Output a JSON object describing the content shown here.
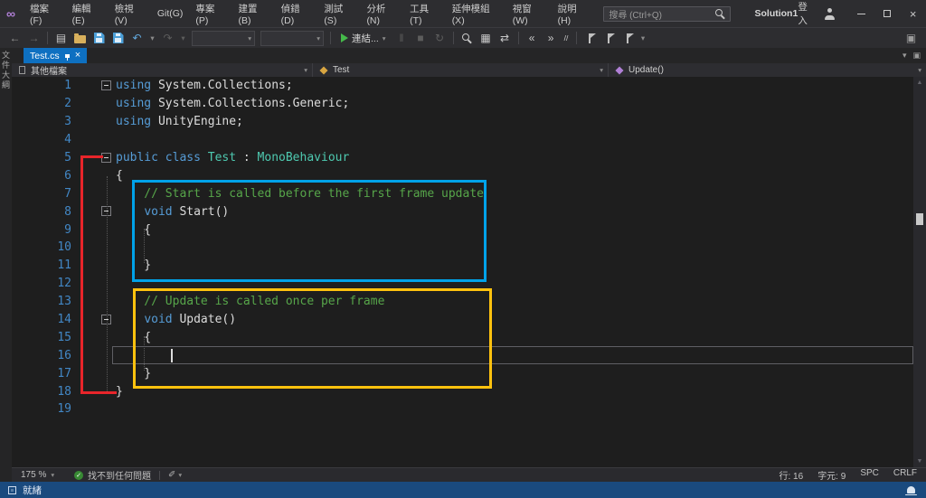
{
  "colors": {
    "keyword": "#569cd6",
    "type": "#4ec9b0",
    "comment": "#57a64a",
    "plain": "#dcdcdc",
    "line_number": "#4287c5",
    "editor_bg": "#1e1e1e",
    "active_tab": "#0e70c1",
    "statusbar_bg": "#1a4a7e",
    "annotation_red": "#e8252a",
    "annotation_blue": "#00a2e9",
    "annotation_yellow": "#ffc20e"
  },
  "titlebar": {
    "menus": [
      "檔案(F)",
      "編輯(E)",
      "檢視(V)",
      "Git(G)",
      "專案(P)",
      "建置(B)",
      "偵錯(D)",
      "測試(S)",
      "分析(N)",
      "工具(T)",
      "延伸模組(X)",
      "視窗(W)",
      "說明(H)"
    ],
    "search_placeholder": "搜尋 (Ctrl+Q)",
    "solution_name": "Solution1",
    "sign_in": "登入"
  },
  "toolbar": {
    "items": [
      {
        "type": "icon",
        "name": "nav-back-icon",
        "glyph": "←",
        "color": "#9b9b9b"
      },
      {
        "type": "icon",
        "name": "nav-forward-icon",
        "glyph": "→",
        "color": "#6d6d6d"
      },
      {
        "type": "sep"
      },
      {
        "type": "icon",
        "name": "new-file-icon",
        "glyph": "▤",
        "color": "#c8c8c8"
      },
      {
        "type": "shape",
        "name": "open-file-icon",
        "cls": "shape-folder"
      },
      {
        "type": "shape",
        "name": "save-icon",
        "cls": "shape-floppy"
      },
      {
        "type": "shape",
        "name": "save-all-icon",
        "cls": "shape-floppy-all"
      },
      {
        "type": "icon",
        "name": "undo-icon",
        "glyph": "↶",
        "color": "#62a8dc"
      },
      {
        "type": "icon",
        "name": "undo-dropdown-icon",
        "glyph": "▾",
        "color": "#8a8a8a",
        "small": true
      },
      {
        "type": "icon",
        "name": "redo-icon",
        "glyph": "↷",
        "color": "#5d5d5d"
      },
      {
        "type": "icon",
        "name": "redo-dropdown-icon",
        "glyph": "▾",
        "color": "#5d5d5d",
        "small": true
      },
      {
        "type": "combo",
        "name": "configuration-combo"
      },
      {
        "type": "combo",
        "name": "platform-combo"
      },
      {
        "type": "sep"
      },
      {
        "type": "start",
        "name": "attach-button",
        "label": "連結..."
      },
      {
        "type": "icon",
        "name": "pause-icon",
        "glyph": "‖",
        "color": "#5d5d5d"
      },
      {
        "type": "icon",
        "name": "stop-icon",
        "glyph": "■",
        "color": "#5d5d5d"
      },
      {
        "type": "icon",
        "name": "restart-icon",
        "glyph": "↻",
        "color": "#5d5d5d"
      },
      {
        "type": "sep"
      },
      {
        "type": "shape",
        "name": "find-icon",
        "cls": "shape-magnifier"
      },
      {
        "type": "icon",
        "name": "show-all-files-icon",
        "glyph": "▦",
        "color": "#c8c8c8"
      },
      {
        "type": "icon",
        "name": "sync-with-active-document-icon",
        "glyph": "⇄",
        "color": "#c8c8c8"
      },
      {
        "type": "sep"
      },
      {
        "type": "icon",
        "name": "indent-decrease-icon",
        "glyph": "«",
        "color": "#c8c8c8"
      },
      {
        "type": "icon",
        "name": "indent-increase-icon",
        "glyph": "»",
        "color": "#c8c8c8"
      },
      {
        "type": "icon",
        "name": "comment-icon",
        "glyph": "//",
        "color": "#c8c8c8",
        "small": true
      },
      {
        "type": "sep"
      },
      {
        "type": "shape",
        "name": "bookmark-icon",
        "cls": "shape-flag"
      },
      {
        "type": "shape",
        "name": "previous-bookmark-icon",
        "cls": "shape-flag"
      },
      {
        "type": "shape",
        "name": "next-bookmark-icon",
        "cls": "shape-flag"
      },
      {
        "type": "icon",
        "name": "toolbar-overflow-icon",
        "glyph": "▾",
        "color": "#8a8a8a",
        "small": true
      },
      {
        "type": "icon",
        "name": "feedback-icon",
        "glyph": "▣",
        "color": "#9b9b9b",
        "right": true
      }
    ]
  },
  "side_panel": {
    "tab_label": "文件大綱"
  },
  "document_tab": {
    "title": "Test.cs"
  },
  "navbar": {
    "project": "其他檔案",
    "type_name": "Test",
    "member_name": "Update()"
  },
  "editor": {
    "lines": [
      {
        "n": 1,
        "fold": true,
        "segs": [
          {
            "c": "k",
            "t": "using"
          },
          {
            "c": "p",
            "t": " System.Collections;"
          }
        ]
      },
      {
        "n": 2,
        "segs": [
          {
            "c": "k",
            "t": "using"
          },
          {
            "c": "p",
            "t": " System.Collections.Generic;"
          }
        ]
      },
      {
        "n": 3,
        "segs": [
          {
            "c": "k",
            "t": "using"
          },
          {
            "c": "p",
            "t": " UnityEngine;"
          }
        ]
      },
      {
        "n": 4,
        "segs": []
      },
      {
        "n": 5,
        "fold": true,
        "segs": [
          {
            "c": "k",
            "t": "public class"
          },
          {
            "c": "p",
            "t": " "
          },
          {
            "c": "t",
            "t": "Test"
          },
          {
            "c": "p",
            "t": " : "
          },
          {
            "c": "t",
            "t": "MonoBehaviour"
          }
        ]
      },
      {
        "n": 6,
        "segs": [
          {
            "c": "p",
            "t": "{"
          }
        ]
      },
      {
        "n": 7,
        "segs": [
          {
            "c": "c",
            "t": "    // Start is called before the first frame update"
          }
        ]
      },
      {
        "n": 8,
        "fold": true,
        "segs": [
          {
            "c": "p",
            "t": "    "
          },
          {
            "c": "k",
            "t": "void"
          },
          {
            "c": "p",
            "t": " Start()"
          }
        ]
      },
      {
        "n": 9,
        "segs": [
          {
            "c": "p",
            "t": "    {"
          }
        ]
      },
      {
        "n": 10,
        "segs": []
      },
      {
        "n": 11,
        "segs": [
          {
            "c": "p",
            "t": "    }"
          }
        ]
      },
      {
        "n": 12,
        "segs": []
      },
      {
        "n": 13,
        "segs": [
          {
            "c": "c",
            "t": "    // Update is called once per frame"
          }
        ]
      },
      {
        "n": 14,
        "fold": true,
        "segs": [
          {
            "c": "p",
            "t": "    "
          },
          {
            "c": "k",
            "t": "void"
          },
          {
            "c": "p",
            "t": " Update()"
          }
        ]
      },
      {
        "n": 15,
        "segs": [
          {
            "c": "p",
            "t": "    {"
          }
        ]
      },
      {
        "n": 16,
        "segs": []
      },
      {
        "n": 17,
        "segs": [
          {
            "c": "p",
            "t": "    }"
          }
        ]
      },
      {
        "n": 18,
        "segs": [
          {
            "c": "p",
            "t": "}"
          }
        ]
      },
      {
        "n": 19,
        "segs": []
      }
    ]
  },
  "editor_status": {
    "zoom": "175 %",
    "health_text": "找不到任何問題",
    "caret_line": "行: 16",
    "caret_column": "字元: 9",
    "indent_mode": "SPC",
    "line_ending": "CRLF"
  },
  "statusbar": {
    "message": "就緒"
  }
}
